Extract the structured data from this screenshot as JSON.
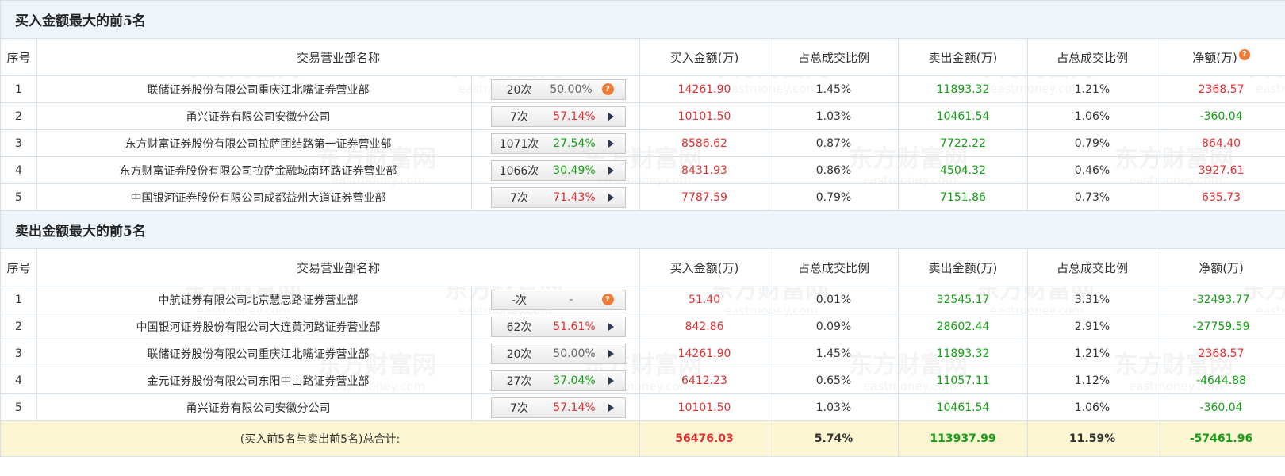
{
  "buy_section": {
    "title": "买入金额最大的前5名",
    "columns": [
      "序号",
      "交易营业部名称",
      "买入金额(万)",
      "占总成交比例",
      "卖出金额(万)",
      "占总成交比例",
      "净额(万)"
    ],
    "rows": [
      {
        "idx": "1",
        "name": "联储证券股份有限公司重庆江北嘴证券营业部",
        "count": "20次",
        "rate": "50.00%",
        "rate_color": "gray",
        "pill_icon": "help",
        "buy": "14261.90",
        "buy_pct": "1.45%",
        "sell": "11893.32",
        "sell_pct": "1.21%",
        "net": "2368.57",
        "net_color": "red"
      },
      {
        "idx": "2",
        "name": "甬兴证券有限公司安徽分公司",
        "count": "7次",
        "rate": "57.14%",
        "rate_color": "red",
        "pill_icon": "arrow",
        "buy": "10101.50",
        "buy_pct": "1.03%",
        "sell": "10461.54",
        "sell_pct": "1.06%",
        "net": "-360.04",
        "net_color": "green"
      },
      {
        "idx": "3",
        "name": "东方财富证券股份有限公司拉萨团结路第一证券营业部",
        "count": "1071次",
        "rate": "27.54%",
        "rate_color": "green",
        "pill_icon": "arrow",
        "buy": "8586.62",
        "buy_pct": "0.87%",
        "sell": "7722.22",
        "sell_pct": "0.79%",
        "net": "864.40",
        "net_color": "red"
      },
      {
        "idx": "4",
        "name": "东方财富证券股份有限公司拉萨金融城南环路证券营业部",
        "count": "1066次",
        "rate": "30.49%",
        "rate_color": "green",
        "pill_icon": "arrow",
        "buy": "8431.93",
        "buy_pct": "0.86%",
        "sell": "4504.32",
        "sell_pct": "0.46%",
        "net": "3927.61",
        "net_color": "red"
      },
      {
        "idx": "5",
        "name": "中国银河证券股份有限公司成都益州大道证券营业部",
        "count": "7次",
        "rate": "71.43%",
        "rate_color": "red",
        "pill_icon": "arrow",
        "buy": "7787.59",
        "buy_pct": "0.79%",
        "sell": "7151.86",
        "sell_pct": "0.73%",
        "net": "635.73",
        "net_color": "red"
      }
    ]
  },
  "sell_section": {
    "title": "卖出金额最大的前5名",
    "columns": [
      "序号",
      "交易营业部名称",
      "买入金额(万)",
      "占总成交比例",
      "卖出金额(万)",
      "占总成交比例",
      "净额(万)"
    ],
    "rows": [
      {
        "idx": "1",
        "name": "中航证券有限公司北京慧忠路证券营业部",
        "count": "-次",
        "rate": "-",
        "rate_color": "gray",
        "pill_icon": "help",
        "buy": "51.40",
        "buy_pct": "0.01%",
        "sell": "32545.17",
        "sell_pct": "3.31%",
        "net": "-32493.77",
        "net_color": "green"
      },
      {
        "idx": "2",
        "name": "中国银河证券股份有限公司大连黄河路证券营业部",
        "count": "62次",
        "rate": "51.61%",
        "rate_color": "red",
        "pill_icon": "arrow",
        "buy": "842.86",
        "buy_pct": "0.09%",
        "sell": "28602.44",
        "sell_pct": "2.91%",
        "net": "-27759.59",
        "net_color": "green"
      },
      {
        "idx": "3",
        "name": "联储证券股份有限公司重庆江北嘴证券营业部",
        "count": "20次",
        "rate": "50.00%",
        "rate_color": "gray",
        "pill_icon": "arrow",
        "buy": "14261.90",
        "buy_pct": "1.45%",
        "sell": "11893.32",
        "sell_pct": "1.21%",
        "net": "2368.57",
        "net_color": "red"
      },
      {
        "idx": "4",
        "name": "金元证券股份有限公司东阳中山路证券营业部",
        "count": "27次",
        "rate": "37.04%",
        "rate_color": "green",
        "pill_icon": "arrow",
        "buy": "6412.23",
        "buy_pct": "0.65%",
        "sell": "11057.11",
        "sell_pct": "1.12%",
        "net": "-4644.88",
        "net_color": "green"
      },
      {
        "idx": "5",
        "name": "甬兴证券有限公司安徽分公司",
        "count": "7次",
        "rate": "57.14%",
        "rate_color": "red",
        "pill_icon": "arrow",
        "buy": "10101.50",
        "buy_pct": "1.03%",
        "sell": "10461.54",
        "sell_pct": "1.06%",
        "net": "-360.04",
        "net_color": "green"
      }
    ]
  },
  "total": {
    "label": "(买入前5名与卖出前5名)总合计:",
    "buy": "56476.03",
    "buy_pct": "5.74%",
    "sell": "113937.99",
    "sell_pct": "11.59%",
    "net": "-57461.96"
  },
  "watermark": {
    "brand_cn": "东方财富网",
    "brand_en": "eastmoney.com"
  },
  "colors": {
    "up": "#e03030",
    "down": "#14a014",
    "header_bg": "#edf4fa",
    "total_bg": "#fdf6d3",
    "help_icon": "#f07c34"
  },
  "icons": {
    "pill_help": "help-circle-icon",
    "pill_arrow": "play-arrow-icon",
    "net_header": "help-circle-icon"
  }
}
